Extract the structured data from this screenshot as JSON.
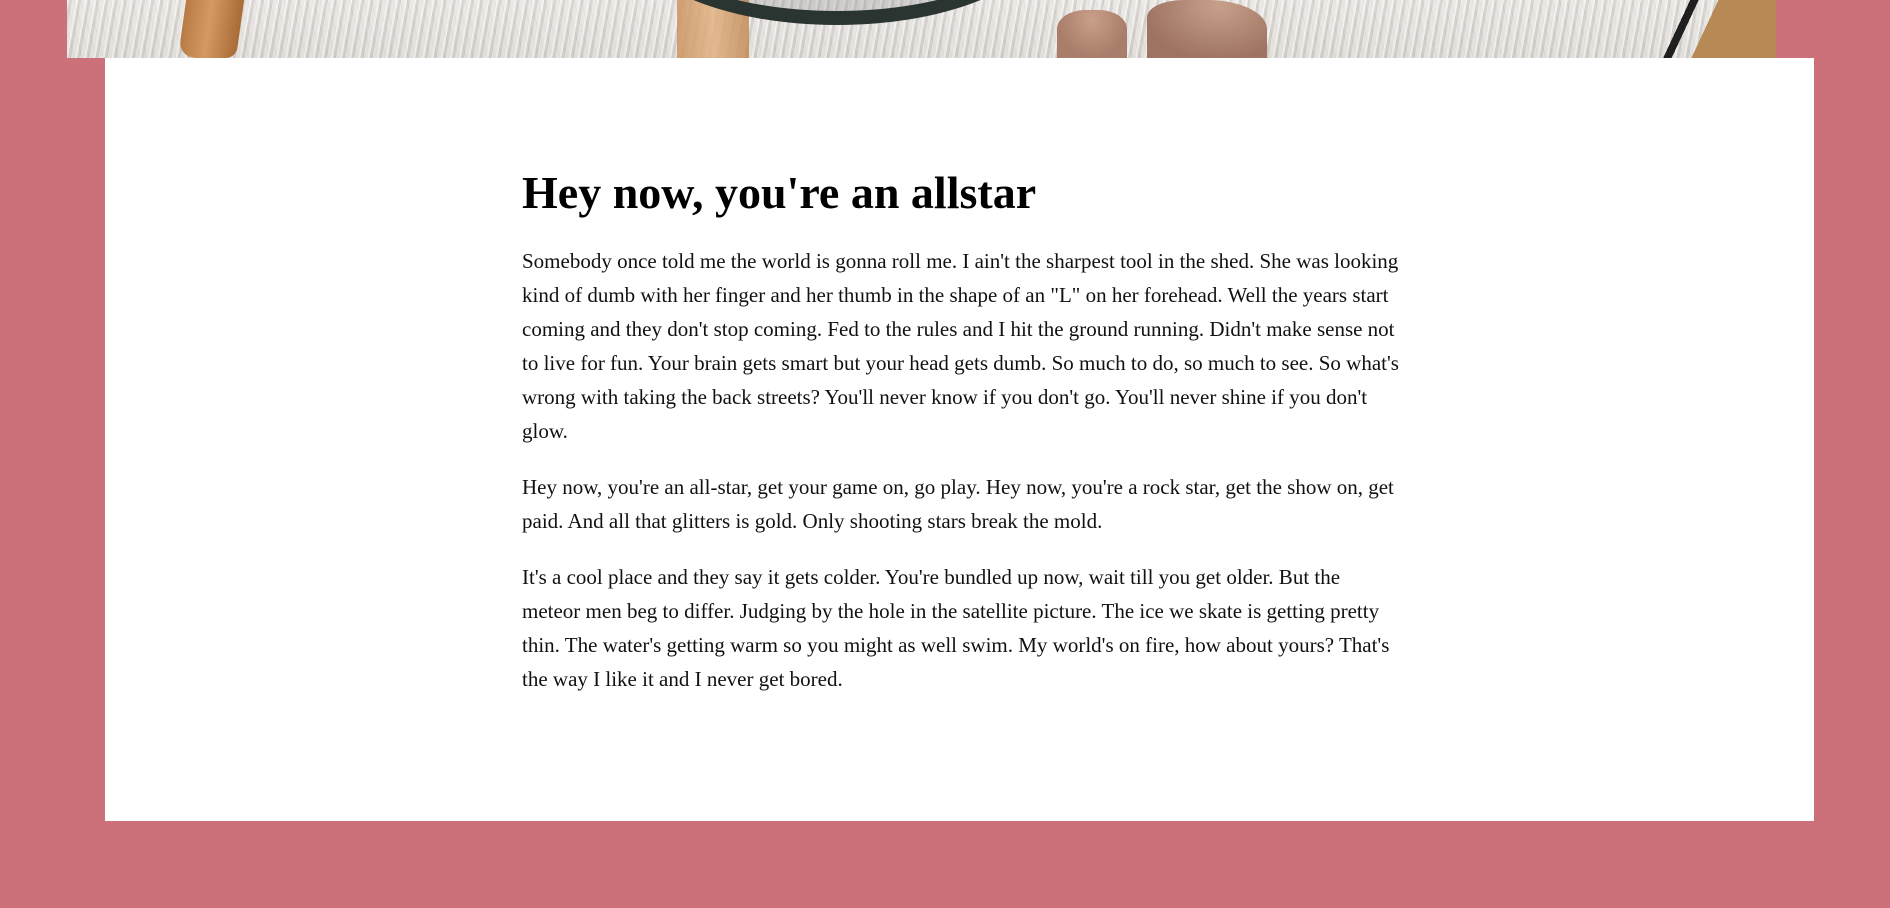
{
  "page": {
    "colors": {
      "background": "#cc717a",
      "card": "#ffffff",
      "text": "#111111"
    }
  },
  "hero": {
    "image_description_icon": "hero-photo"
  },
  "article": {
    "title": "Hey now, you're an allstar",
    "paragraphs": [
      "Somebody once told me the world is gonna roll me. I ain't the sharpest tool in the shed. She was looking kind of dumb with her finger and her thumb in the shape of an \"L\" on her forehead. Well the years start coming and they don't stop coming. Fed to the rules and I hit the ground running. Didn't make sense not to live for fun. Your brain gets smart but your head gets dumb. So much to do, so much to see. So what's wrong with taking the back streets? You'll never know if you don't go. You'll never shine if you don't glow.",
      "Hey now, you're an all-star, get your game on, go play. Hey now, you're a rock star, get the show on, get paid. And all that glitters is gold. Only shooting stars break the mold.",
      "It's a cool place and they say it gets colder. You're bundled up now, wait till you get older. But the meteor men beg to differ. Judging by the hole in the satellite picture. The ice we skate is getting pretty thin. The water's getting warm so you might as well swim. My world's on fire, how about yours? That's the way I like it and I never get bored."
    ]
  }
}
